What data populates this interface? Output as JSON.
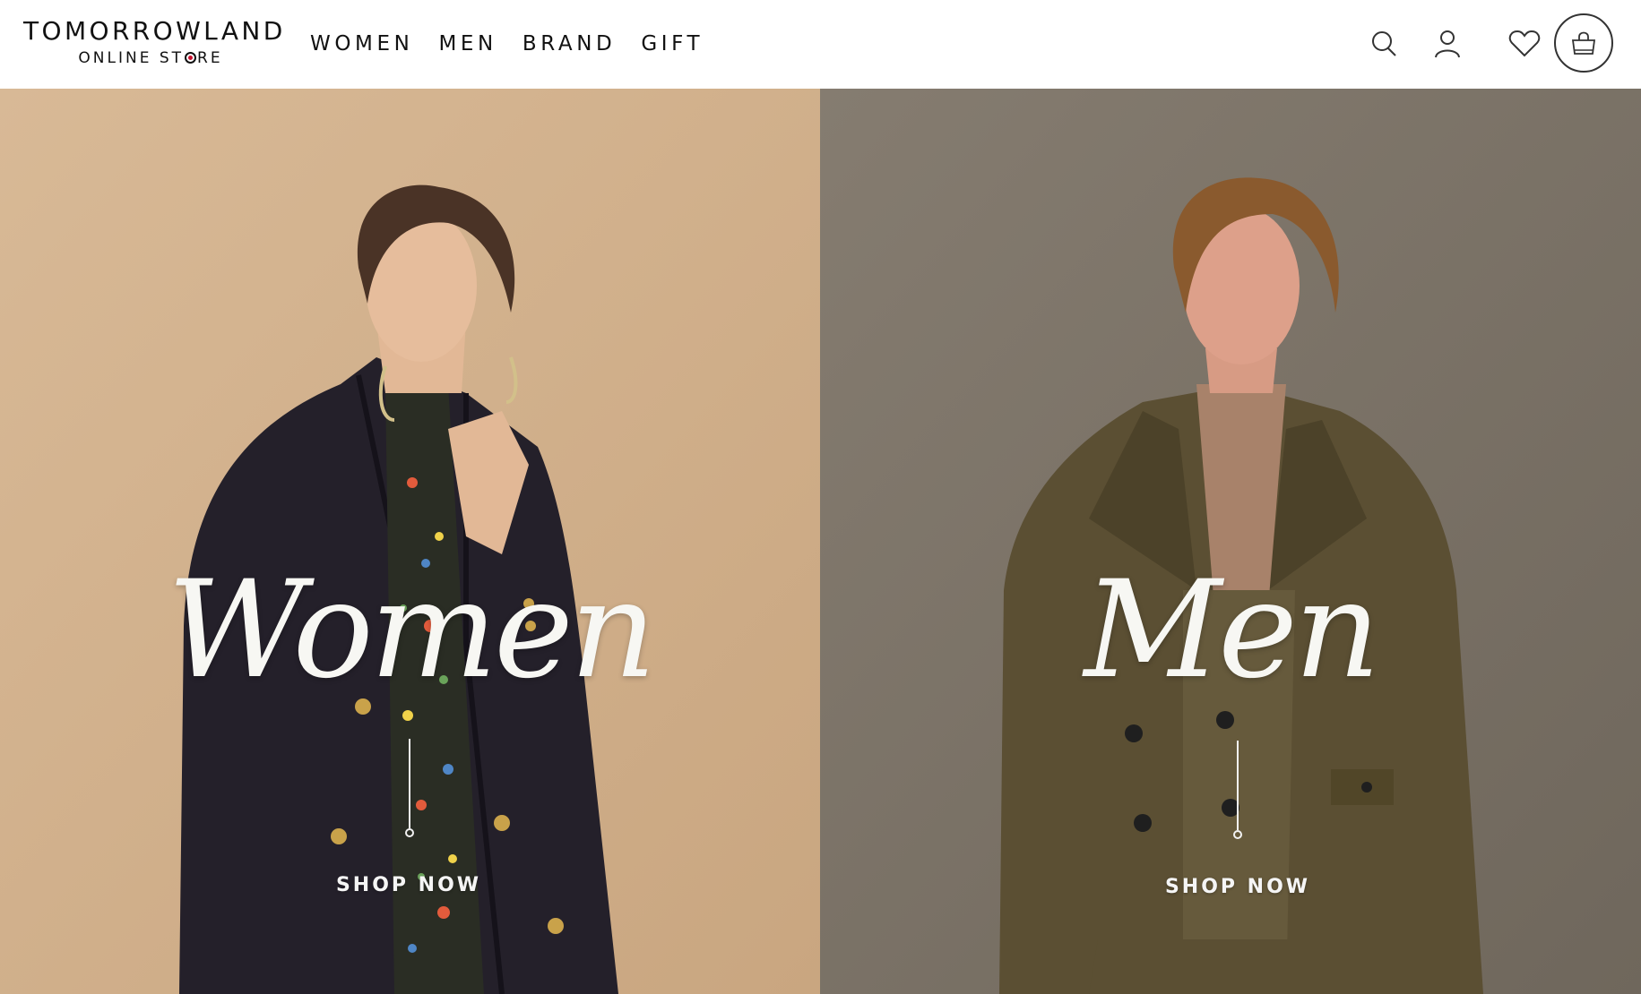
{
  "logo": {
    "line1": "TOMORROWLAND",
    "line2_a": "ONLINE ST",
    "line2_b": "RE"
  },
  "nav": [
    {
      "label": "WOMEN"
    },
    {
      "label": "MEN"
    },
    {
      "label": "BRAND"
    },
    {
      "label": "GIFT"
    }
  ],
  "header_icons": [
    "search-icon",
    "user-icon",
    "heart-icon",
    "shopping-bag-icon"
  ],
  "hero": {
    "women": {
      "title": "Women",
      "cta": "SHOP NOW",
      "bg_color": "#d3b390"
    },
    "men": {
      "title": "Men",
      "cta": "SHOP NOW",
      "bg_color": "#7e766a"
    }
  }
}
